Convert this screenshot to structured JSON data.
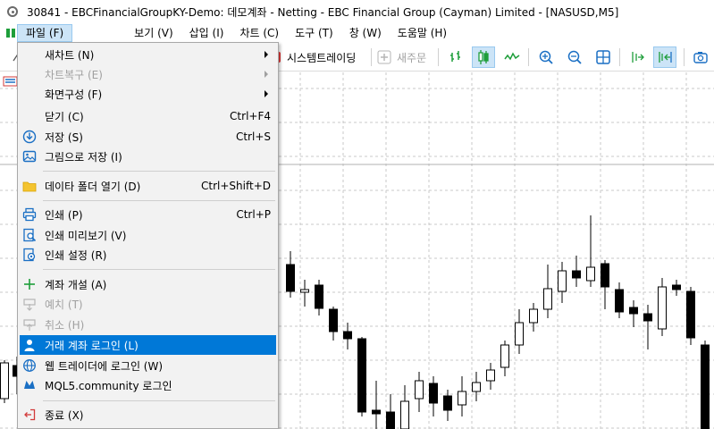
{
  "window": {
    "title": "30841 - EBCFinancialGroupKY-Demo: 데모계좌 - Netting - EBC Financial Group (Cayman) Limited - [NASUSD,M5]"
  },
  "menubar": {
    "items": [
      {
        "label": "파일 (F)",
        "active": true
      },
      {
        "label": "보기 (V)"
      },
      {
        "label": "삽입 (I)"
      },
      {
        "label": "차트 (C)"
      },
      {
        "label": "도구 (T)"
      },
      {
        "label": "창 (W)"
      },
      {
        "label": "도움말 (H)"
      }
    ]
  },
  "toolbar": {
    "algo_label": "시스템트레이딩",
    "new_order_label": "새주문"
  },
  "file_menu": {
    "items": [
      {
        "label": "새차트 (N)",
        "submenu": true
      },
      {
        "label": "차트복구 (E)",
        "submenu": true,
        "disabled": true
      },
      {
        "label": "화면구성 (F)",
        "submenu": true
      },
      {
        "label": "닫기 (C)",
        "shortcut": "Ctrl+F4"
      },
      {
        "label": "저장 (S)",
        "shortcut": "Ctrl+S",
        "icon": "save-icon"
      },
      {
        "label": "그림으로 저장 (I)",
        "icon": "picture-icon"
      },
      {
        "label": "데이타 폴더 열기 (D)",
        "shortcut": "Ctrl+Shift+D",
        "icon": "folder-icon"
      },
      {
        "label": "인쇄 (P)",
        "shortcut": "Ctrl+P",
        "icon": "printer-icon"
      },
      {
        "label": "인쇄 미리보기 (V)",
        "icon": "print-preview-icon"
      },
      {
        "label": "인쇄 설정 (R)",
        "icon": "print-settings-icon"
      },
      {
        "label": "계좌 개설 (A)",
        "icon": "plus-icon"
      },
      {
        "label": "예치 (T)",
        "icon": "deposit-icon",
        "disabled": true
      },
      {
        "label": "취소 (H)",
        "icon": "withdraw-icon",
        "disabled": true
      },
      {
        "label": "거래 계좌 로그인 (L)",
        "icon": "user-icon",
        "highlighted": true
      },
      {
        "label": "웹 트레이더에 로그인 (W)",
        "icon": "globe-icon"
      },
      {
        "label": "MQL5.community 로그인",
        "icon": "mql5-icon"
      },
      {
        "label": "종료 (X)",
        "icon": "exit-icon"
      }
    ]
  },
  "colors": {
    "menu_highlight": "#0078d7",
    "menu_active": "#cce4f7",
    "toolbar_green": "#1e9e3a",
    "toolbar_blue": "#1a6fc4",
    "grid": "#c8c8c8"
  }
}
